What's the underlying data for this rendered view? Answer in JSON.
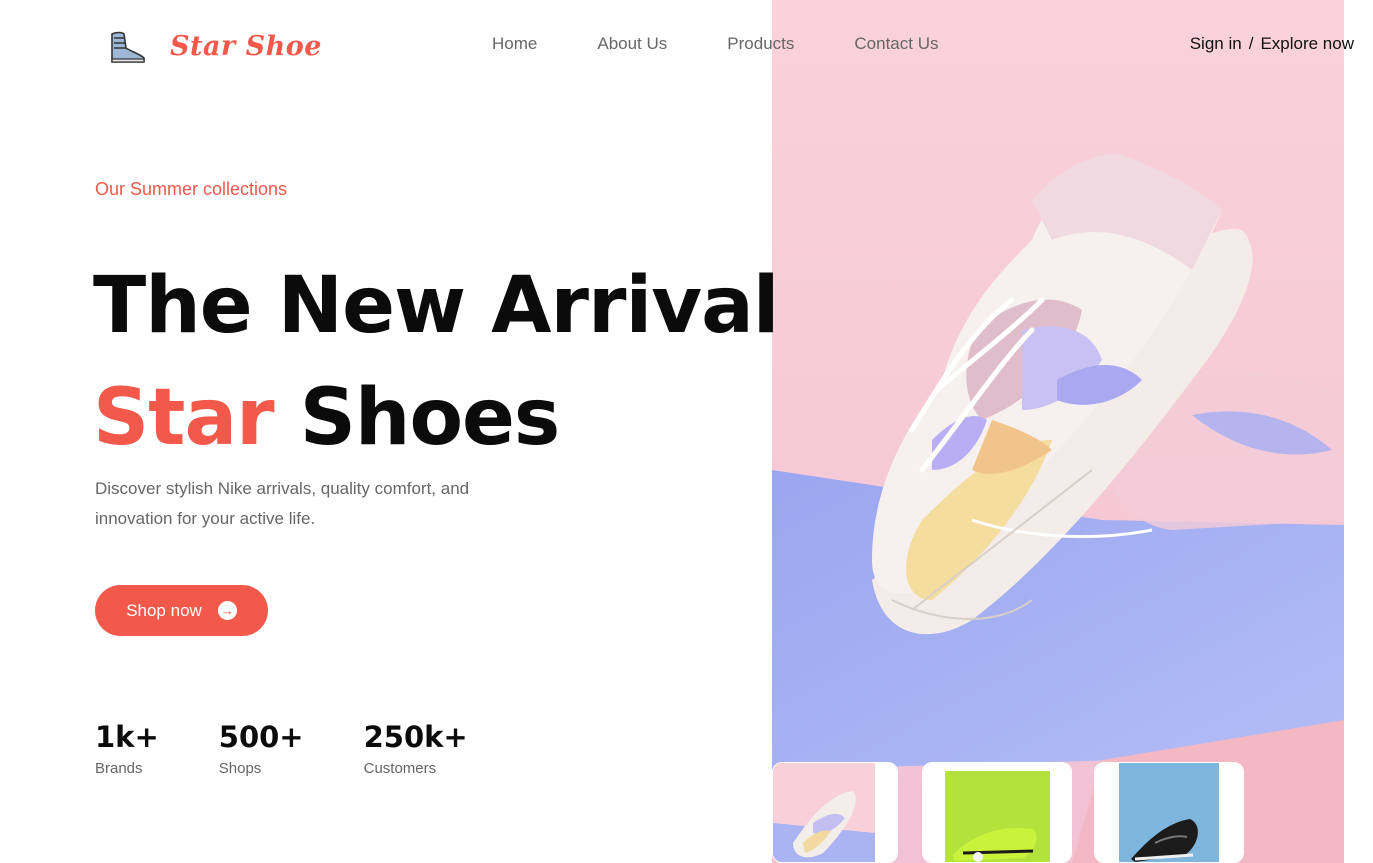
{
  "brand": {
    "name": "Star Shoe",
    "logo_icon": "sneaker-icon"
  },
  "nav": {
    "items": [
      {
        "label": "Home"
      },
      {
        "label": "About Us"
      },
      {
        "label": "Products"
      },
      {
        "label": "Contact Us"
      }
    ]
  },
  "auth": {
    "sign_in": "Sign in",
    "separator": "/",
    "explore": "Explore now"
  },
  "hero": {
    "eyebrow": "Our Summer collections",
    "headline_line1": "The New Arrival",
    "headline_accent": "Star",
    "headline_rest": "Shoes",
    "description": "Discover stylish Nike arrivals, quality comfort, and innovation for your active life.",
    "cta_label": "Shop now",
    "cta_icon": "arrow-right-circle-icon"
  },
  "stats": [
    {
      "value": "1k+",
      "label": "Brands"
    },
    {
      "value": "500+",
      "label": "Shops"
    },
    {
      "value": "250k+",
      "label": "Customers"
    }
  ],
  "colors": {
    "accent": "#f2594b",
    "text": "#0b0b0b",
    "muted": "#666666"
  },
  "thumbnails": [
    {
      "name": "pastel-sneaker"
    },
    {
      "name": "lime-sneaker"
    },
    {
      "name": "black-sneaker"
    }
  ]
}
